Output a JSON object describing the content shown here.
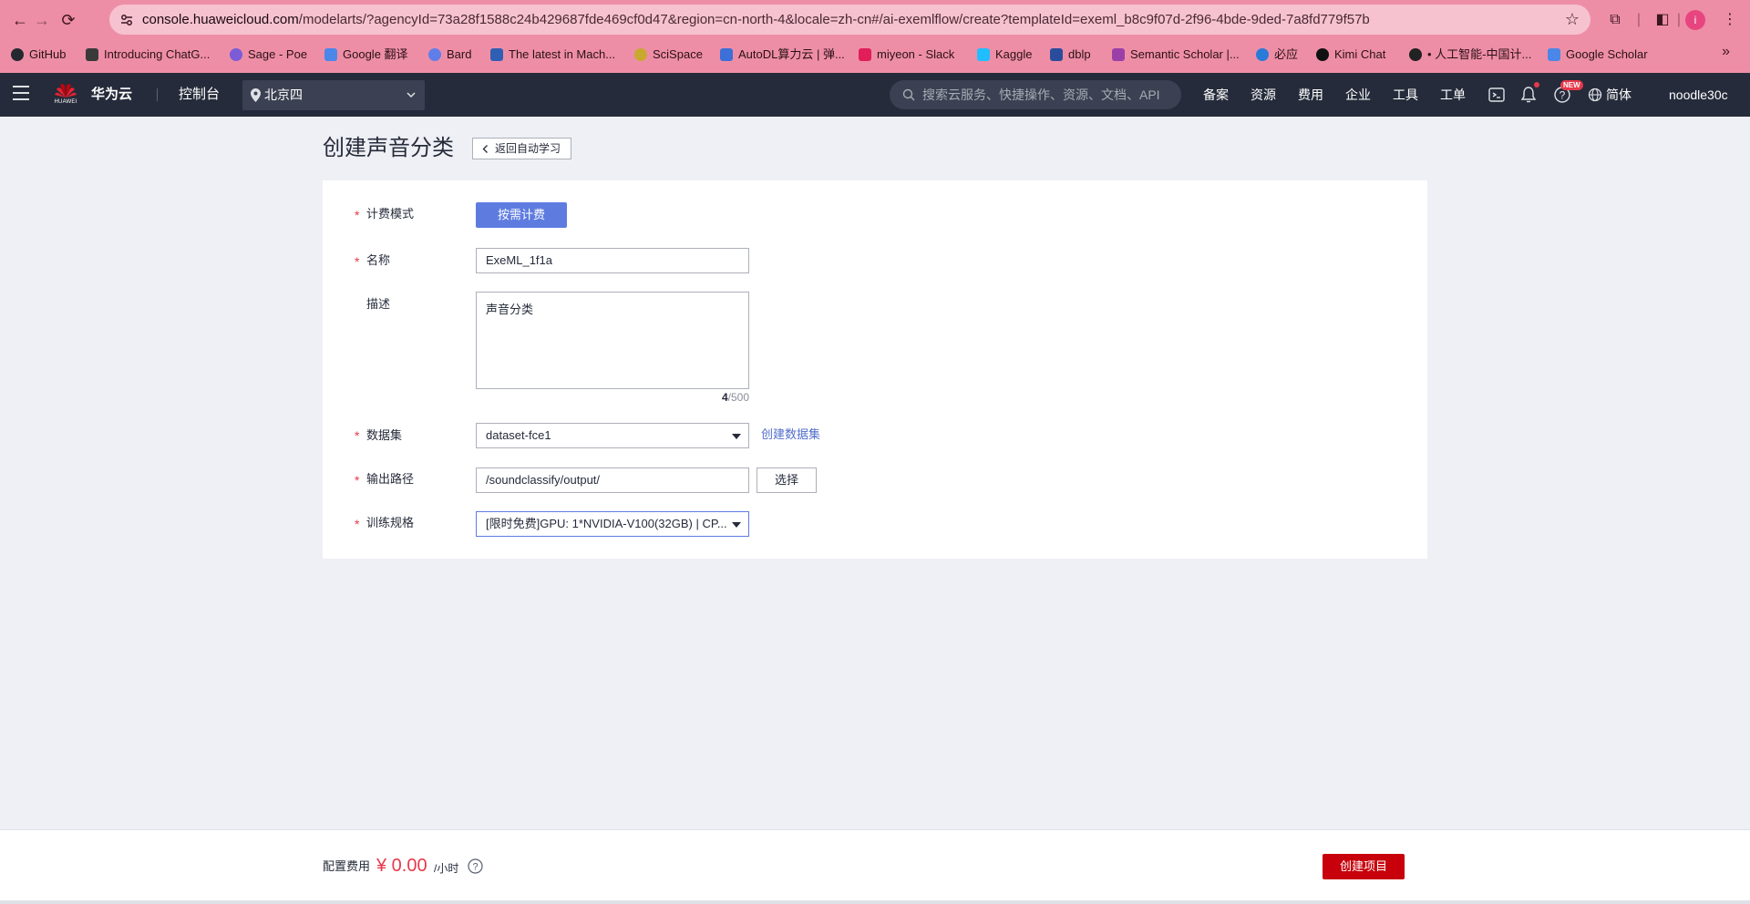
{
  "browser": {
    "url_host": "console.huaweicloud.com",
    "url_rest": "/modelarts/?agencyId=73a28f1588c24b429687fde469cf0d47&region=cn-north-4&locale=zh-cn#/ai-exemlflow/create?templateId=exeml_b8c9f07d-2f96-4bde-9ded-7a8fd779f57b",
    "profile_initial": "i",
    "bookmarks": [
      {
        "label": "GitHub",
        "color": "#24292f"
      },
      {
        "label": "Introducing ChatG...",
        "color": "#3a3a3a"
      },
      {
        "label": "Sage - Poe",
        "color": "#7b5cd6"
      },
      {
        "label": "Google 翻译",
        "color": "#4a87e8"
      },
      {
        "label": "Bard",
        "color": "#5f7ee8"
      },
      {
        "label": "The latest in Mach...",
        "color": "#2f5fb3"
      },
      {
        "label": "SciSpace",
        "color": "#c9a830"
      },
      {
        "label": "AutoDL算力云 | 弹...",
        "color": "#3c6fd8"
      },
      {
        "label": "miyeon - Slack",
        "color": "#e01e5a"
      },
      {
        "label": "Kaggle",
        "color": "#20beff"
      },
      {
        "label": "dblp",
        "color": "#2a4d9b"
      },
      {
        "label": "Semantic Scholar |...",
        "color": "#9b3fa8"
      },
      {
        "label": "必应",
        "color": "#2a7ad8"
      },
      {
        "label": "Kimi Chat",
        "color": "#111111"
      },
      {
        "label": "• 人工智能-中国计...",
        "color": "#222222"
      },
      {
        "label": "Google Scholar",
        "color": "#4a87e8"
      }
    ]
  },
  "header": {
    "brand_small": "HUAWEI",
    "brand_name": "华为云",
    "console": "控制台",
    "region": "北京四",
    "search_placeholder": "搜索云服务、快捷操作、资源、文档、API",
    "nav": [
      "备案",
      "资源",
      "费用",
      "企业",
      "工具",
      "工单"
    ],
    "new_badge": "NEW",
    "language": "简体",
    "username": "noodle30c"
  },
  "page": {
    "title": "创建声音分类",
    "back_label": "返回自动学习"
  },
  "form": {
    "billing_label": "计费模式",
    "billing_value": "按需计费",
    "name_label": "名称",
    "name_value": "ExeML_1f1a",
    "desc_label": "描述",
    "desc_value": "声音分类",
    "desc_count": "4",
    "desc_max": "/500",
    "dataset_label": "数据集",
    "dataset_value": "dataset-fce1",
    "dataset_create_link": "创建数据集",
    "output_label": "输出路径",
    "output_value": "/soundclassify/output/",
    "output_select": "选择",
    "spec_label": "训练规格",
    "spec_value": "[限时免费]GPU: 1*NVIDIA-V100(32GB) | CP..."
  },
  "footer": {
    "fee_label": "配置费用",
    "fee_value": "¥ 0.00",
    "fee_unit": "/小时",
    "create_label": "创建项目"
  },
  "colors": {
    "brand_red": "#c7000b",
    "primary_blue": "#5e7ce0",
    "link_blue": "#526ecc",
    "required_red": "#e6394b",
    "header_bg": "#252b3a"
  }
}
